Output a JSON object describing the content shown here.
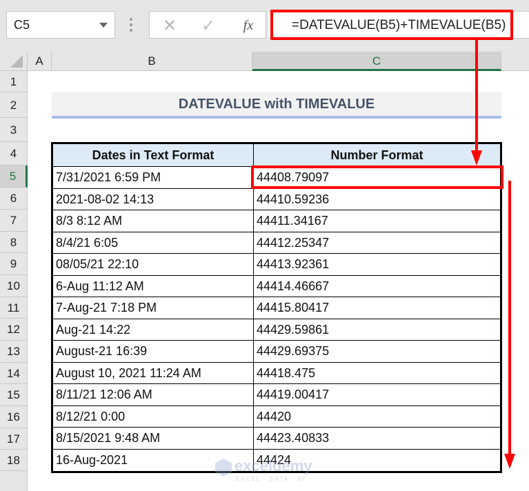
{
  "formula_bar": {
    "name_box": "C5",
    "cancel_icon": "✕",
    "enter_icon": "✓",
    "function_icon": "fx",
    "formula": "=DATEVALUE(B5)+TIMEVALUE(B5)"
  },
  "columns": [
    "A",
    "B",
    "C"
  ],
  "selected_column": "C",
  "rows": [
    "1",
    "2",
    "3",
    "4",
    "5",
    "6",
    "7",
    "8",
    "9",
    "10",
    "11",
    "12",
    "13",
    "14",
    "15",
    "16",
    "17",
    "18"
  ],
  "selected_row": "5",
  "sheet": {
    "title": "DATEVALUE with TIMEVALUE",
    "table": {
      "headers": [
        "Dates in Text Format",
        "Number Format"
      ],
      "rows": [
        [
          "7/31/2021 6:59 PM",
          "44408.79097"
        ],
        [
          "2021-08-02 14:13",
          "44410.59236"
        ],
        [
          "8/3 8:12 AM",
          "44411.34167"
        ],
        [
          "8/4/21 6:05",
          "44412.25347"
        ],
        [
          "08/05/21 22:10",
          "44413.92361"
        ],
        [
          "6-Aug 11:12 AM",
          "44414.46667"
        ],
        [
          "7-Aug-21 7:18 PM",
          "44415.80417"
        ],
        [
          "Aug-21 14:22",
          "44429.59861"
        ],
        [
          "August-21 16:39",
          "44429.69375"
        ],
        [
          "August 10, 2021 11:24 AM",
          "44418.475"
        ],
        [
          "8/11/21 12:06 AM",
          "44419.00417"
        ],
        [
          "8/12/21 0:00",
          "44420"
        ],
        [
          "8/15/2021 9:48 AM",
          "44423.40833"
        ],
        [
          "16-Aug-2021",
          "44424"
        ]
      ]
    }
  },
  "annotation_color": "#ff0000",
  "watermark": {
    "name": "exceldemy",
    "tagline": "EXCEL · DATA · BI"
  }
}
